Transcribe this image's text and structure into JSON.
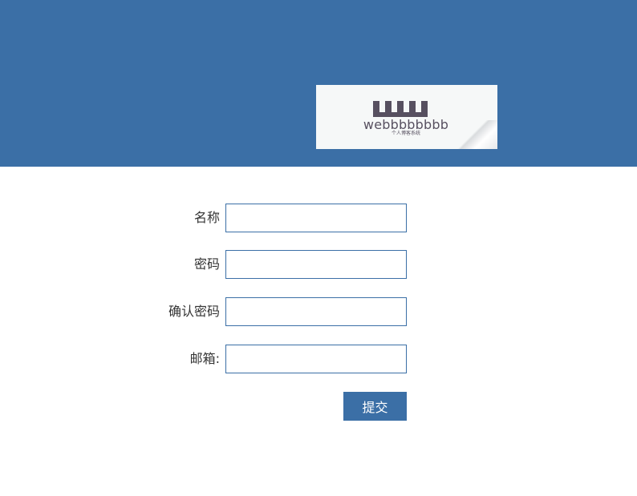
{
  "header": {
    "logo": {
      "text": "webbbbbbbb",
      "subtitle": "个人博客系统"
    },
    "color": "#3b6fa6"
  },
  "form": {
    "fields": [
      {
        "label": "名称",
        "value": "",
        "placeholder": ""
      },
      {
        "label": "密码",
        "value": "",
        "placeholder": ""
      },
      {
        "label": "确认密码",
        "value": "",
        "placeholder": ""
      },
      {
        "label": "邮箱:",
        "value": "",
        "placeholder": ""
      }
    ],
    "submit_label": "提交"
  }
}
